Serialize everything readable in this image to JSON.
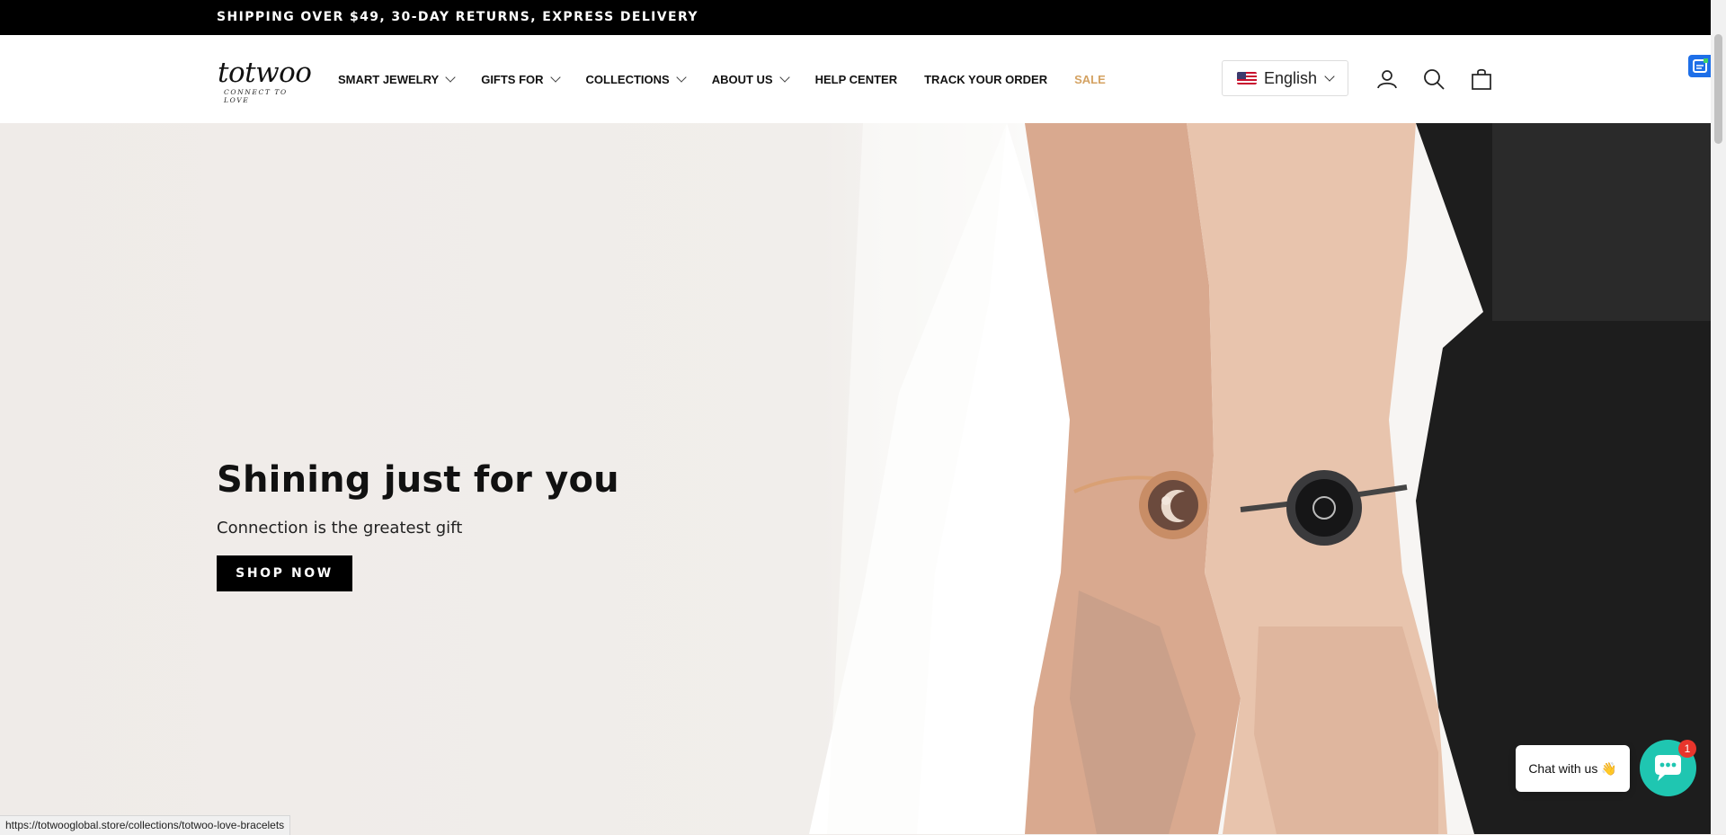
{
  "announcement": {
    "text": "SHIPPING OVER $49, 30-DAY RETURNS, EXPRESS DELIVERY"
  },
  "brand": {
    "name": "totwoo",
    "tagline": "CONNECT TO LOVE"
  },
  "nav": {
    "items": [
      {
        "label": "SMART JEWELRY",
        "dropdown": true
      },
      {
        "label": "GIFTS FOR",
        "dropdown": true
      },
      {
        "label": "COLLECTIONS",
        "dropdown": true
      },
      {
        "label": "ABOUT US",
        "dropdown": true
      },
      {
        "label": "HELP CENTER",
        "dropdown": false
      },
      {
        "label": "TRACK YOUR ORDER",
        "dropdown": false
      },
      {
        "label": "SALE",
        "dropdown": false,
        "color": "#d4a262"
      }
    ]
  },
  "language": {
    "selected": "English",
    "flag": "us-flag-icon"
  },
  "header_icons": [
    "account-icon",
    "search-icon",
    "cart-icon"
  ],
  "hero": {
    "title": "Shining just for you",
    "subtitle": "Connection is the greatest gift",
    "cta": "SHOP NOW"
  },
  "chat": {
    "bubble_text": "Chat with us 👋",
    "badge_count": "1",
    "color": "#1fc6b1"
  },
  "status_bar": {
    "url": "https://totwooglobal.store/collections/totwoo-love-bracelets"
  },
  "colors": {
    "accent_sale": "#d4a262",
    "announcement_bg": "#000000",
    "chat": "#1fc6b1",
    "badge": "#e8352c"
  }
}
